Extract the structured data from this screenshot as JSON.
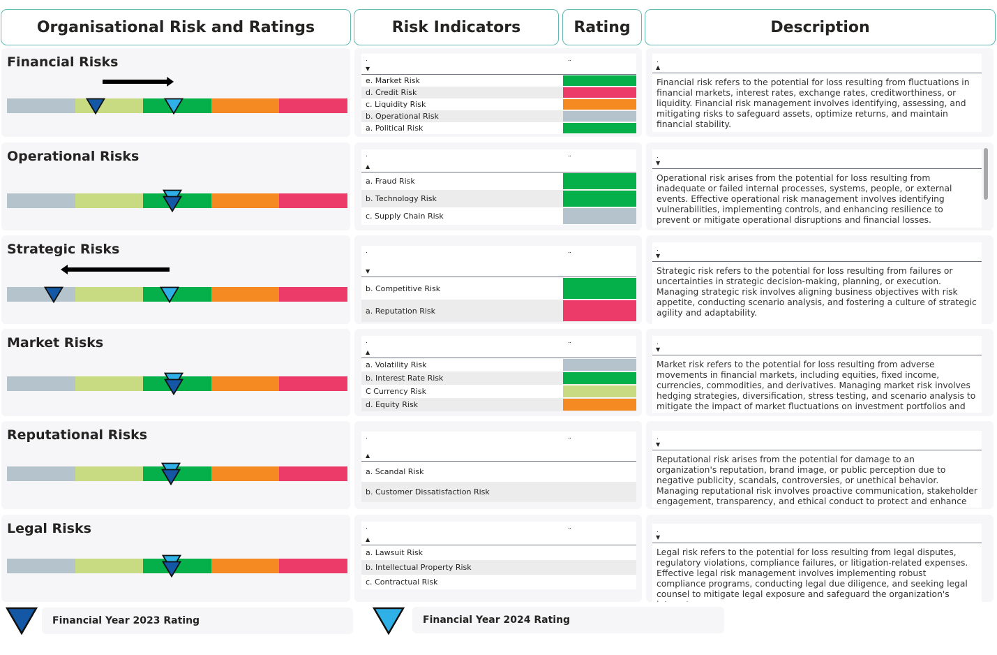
{
  "headers": {
    "org_risk": "Organisational Risk and Ratings",
    "indicators": "Risk Indicators",
    "rating": "Rating",
    "description": "Description"
  },
  "colors": {
    "rating_scale": [
      "#b4c3cc",
      "#c8db82",
      "#05b04a",
      "#f58a22",
      "#ec3b68"
    ],
    "fy2023_marker": "#1457a4",
    "fy2024_marker": "#2fb1e8",
    "header_border": "#5fb8b4",
    "card_background": "#f6f6f8"
  },
  "rating_scale_levels": 5,
  "legend": {
    "fy2023": "Financial Year 2023 Rating",
    "fy2024": "Financial Year 2024 Rating"
  },
  "categories": [
    {
      "title": "Financial Risks",
      "fy2023_position": 0.26,
      "fy2024_position": 0.49,
      "trend": "right",
      "table_sort_icon": "sort-descending",
      "table_header_col1": ".",
      "table_header_col2": "..",
      "indicators": [
        {
          "label": "e. Market Risk",
          "rating_color": "#05b04a"
        },
        {
          "label": "d. Credit Risk",
          "rating_color": "#ec3b68"
        },
        {
          "label": "c. Liquidity Risk",
          "rating_color": "#f58a22"
        },
        {
          "label": "b. Operational Risk",
          "rating_color": "#b4c3cc"
        },
        {
          "label": "a. Political Risk",
          "rating_color": "#05b04a"
        }
      ],
      "desc_header": ".",
      "desc_sort_icon": "sort-ascending",
      "description": "Financial risk refers to the potential for loss resulting from fluctuations in financial markets, interest rates, exchange rates, creditworthiness, or liquidity. Financial risk management involves identifying, assessing, and mitigating risks to safeguard assets, optimize returns, and maintain financial stability."
    },
    {
      "title": "Operational Risks",
      "fy2023_position": 0.485,
      "fy2024_position": 0.485,
      "trend": "none",
      "table_sort_icon": "sort-ascending",
      "table_header_col1": ".",
      "table_header_col2": "..",
      "indicators": [
        {
          "label": "a. Fraud Risk",
          "rating_color": "#05b04a"
        },
        {
          "label": "b. Technology Risk",
          "rating_color": "#05b04a"
        },
        {
          "label": "c. Supply Chain Risk",
          "rating_color": "#b4c3cc"
        }
      ],
      "desc_header": ".",
      "desc_sort_icon": "sort-descending",
      "description": "Operational risk arises from the potential for loss resulting from inadequate or failed internal processes, systems, people, or external events. Effective operational risk management involves identifying vulnerabilities, implementing controls, and enhancing resilience to prevent or mitigate operational disruptions and financial losses."
    },
    {
      "title": "Strategic Risks",
      "fy2023_position": 0.137,
      "fy2024_position": 0.478,
      "trend": "left",
      "table_sort_icon": "sort-descending",
      "table_header_col1": ".",
      "table_header_col2": "..",
      "indicators": [
        {
          "label": "b. Competitive Risk",
          "rating_color": "#05b04a"
        },
        {
          "label": "a. Reputation Risk",
          "rating_color": "#ec3b68"
        }
      ],
      "desc_header": ".",
      "desc_sort_icon": "sort-descending",
      "description": "Strategic risk refers to the potential for loss resulting from failures or uncertainties in strategic decision-making, planning, or execution. Managing strategic risk involves aligning business objectives with risk appetite, conducting scenario analysis, and fostering a culture of strategic agility and adaptability."
    },
    {
      "title": "Market Risks",
      "fy2023_position": 0.49,
      "fy2024_position": 0.49,
      "trend": "none",
      "table_sort_icon": "sort-ascending",
      "table_header_col1": ".",
      "table_header_col2": "..",
      "indicators": [
        {
          "label": "a. Volatility Risk",
          "rating_color": "#b4c3cc"
        },
        {
          "label": "b. Interest Rate Risk",
          "rating_color": "#05b04a"
        },
        {
          "label": "C Currency Risk",
          "rating_color": "#c8db82"
        },
        {
          "label": "d. Equity Risk",
          "rating_color": "#f58a22"
        }
      ],
      "desc_header": ".",
      "desc_sort_icon": "sort-descending",
      "description": "Market risk refers to the potential for loss resulting from adverse movements in financial markets, including equities, fixed income, currencies, commodities, and derivatives. Managing market risk involves hedging strategies, diversification, stress testing, and scenario analysis to mitigate the impact of market fluctuations on investment portfolios and financial performance."
    },
    {
      "title": "Reputational Risks",
      "fy2023_position": 0.482,
      "fy2024_position": 0.482,
      "trend": "none",
      "table_sort_icon": "sort-ascending",
      "table_header_col1": ".",
      "table_header_col2": "..",
      "indicators": [
        {
          "label": "a. Scandal Risk",
          "rating_color": ""
        },
        {
          "label": "b. Customer Dissatisfaction Risk",
          "rating_color": ""
        }
      ],
      "desc_header": ".",
      "desc_sort_icon": "sort-descending",
      "description": "Reputational risk arises from the potential for damage to an organization's reputation, brand image, or public perception due to negative publicity, scandals, controversies, or unethical behavior. Managing reputational risk involves proactive communication, stakeholder engagement, transparency, and ethical conduct to protect and enhance the organization's reputation and trustworthiness."
    },
    {
      "title": "Legal Risks",
      "fy2023_position": 0.483,
      "fy2024_position": 0.483,
      "trend": "none",
      "table_sort_icon": "sort-ascending",
      "table_header_col1": ".",
      "table_header_col2": "..",
      "indicators": [
        {
          "label": "a. Lawsuit Risk",
          "rating_color": ""
        },
        {
          "label": "b. Intellectual Property Risk",
          "rating_color": ""
        },
        {
          "label": "c. Contractual Risk",
          "rating_color": ""
        }
      ],
      "desc_header": ".",
      "desc_sort_icon": "sort-descending",
      "description": "Legal risk refers to the potential for loss resulting from legal disputes, regulatory violations, compliance failures, or litigation-related expenses. Effective legal risk management involves implementing robust compliance programs, conducting legal due diligence, and seeking legal counsel to mitigate legal exposure and safeguard the organization's interests."
    }
  ]
}
